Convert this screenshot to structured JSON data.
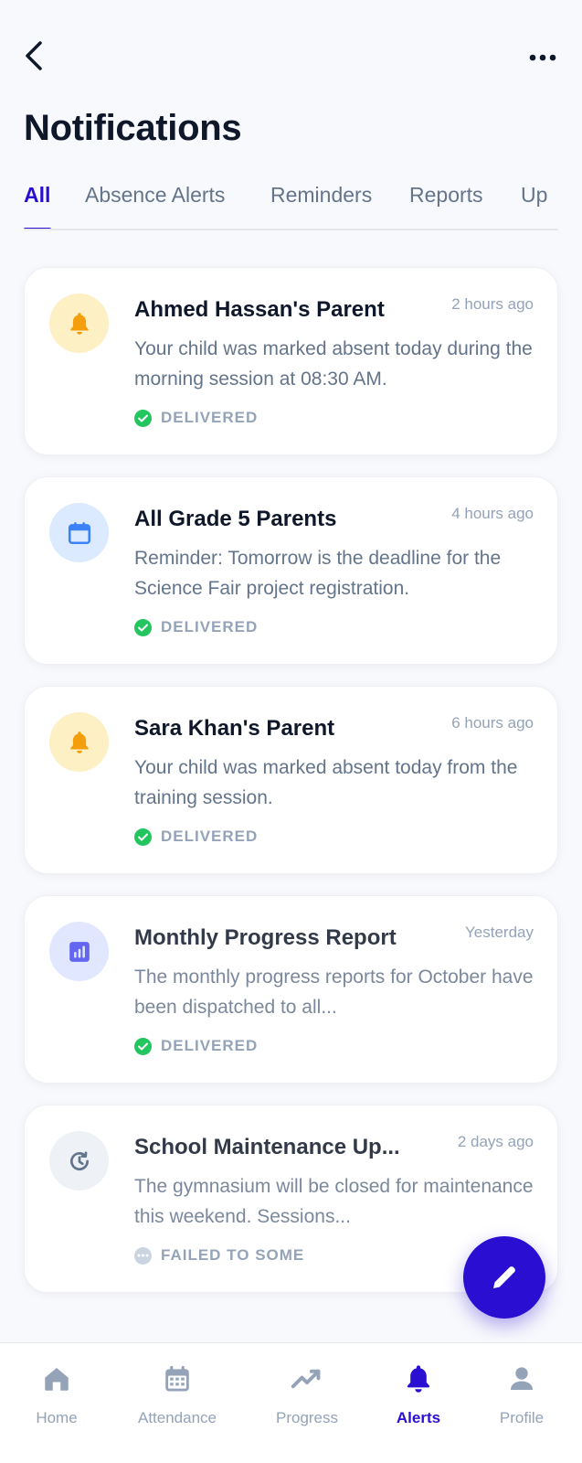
{
  "header": {
    "title": "Notifications"
  },
  "tabs": [
    {
      "label": "All",
      "active": true
    },
    {
      "label": "Absence Alerts"
    },
    {
      "label": "Reminders"
    },
    {
      "label": "Reports"
    },
    {
      "label": "Up"
    }
  ],
  "notifications": [
    {
      "recipient": "Ahmed Hassan's Parent",
      "time": "2 hours ago",
      "message": "Your child was marked absent today during the morning session at 08:30 AM.",
      "status": "DELIVERED",
      "icon": "bell-icon"
    },
    {
      "recipient": "All Grade 5 Parents",
      "time": "4 hours ago",
      "message": "Reminder: Tomorrow is the deadline for the Science Fair project registration.",
      "status": "DELIVERED",
      "icon": "calendar-icon"
    },
    {
      "recipient": "Sara Khan's Parent",
      "time": "6 hours ago",
      "message": "Your child was marked absent today from the training session.",
      "status": "DELIVERED",
      "icon": "bell-icon"
    },
    {
      "recipient": "Monthly Progress Report",
      "time": "Yesterday",
      "message": "The monthly progress reports for October have been dispatched to all...",
      "status": "DELIVERED",
      "icon": "chart-icon"
    },
    {
      "recipient": "School Maintenance Up...",
      "time": "2 days ago",
      "message": "The gymnasium will be closed for maintenance this weekend. Sessions...",
      "status": "FAILED TO SOME",
      "icon": "history-icon"
    }
  ],
  "nav": [
    {
      "label": "Home",
      "icon": "home-icon"
    },
    {
      "label": "Attendance",
      "icon": "calendar-icon"
    },
    {
      "label": "Progress",
      "icon": "trending-up-icon"
    },
    {
      "label": "Alerts",
      "icon": "bell-icon",
      "active": true
    },
    {
      "label": "Profile",
      "icon": "user-icon"
    }
  ],
  "colors": {
    "accent": "#2a0fd3",
    "success": "#22c55e",
    "amber": "#f59e0b",
    "amber_bg": "#fdf0c4",
    "blue": "#3b82f6",
    "blue_bg": "#dbeafe",
    "indigo": "#6366f1",
    "indigo_bg": "#e0e7ff",
    "muted": "#94a3b8",
    "muted_bg": "#eef1f6"
  }
}
